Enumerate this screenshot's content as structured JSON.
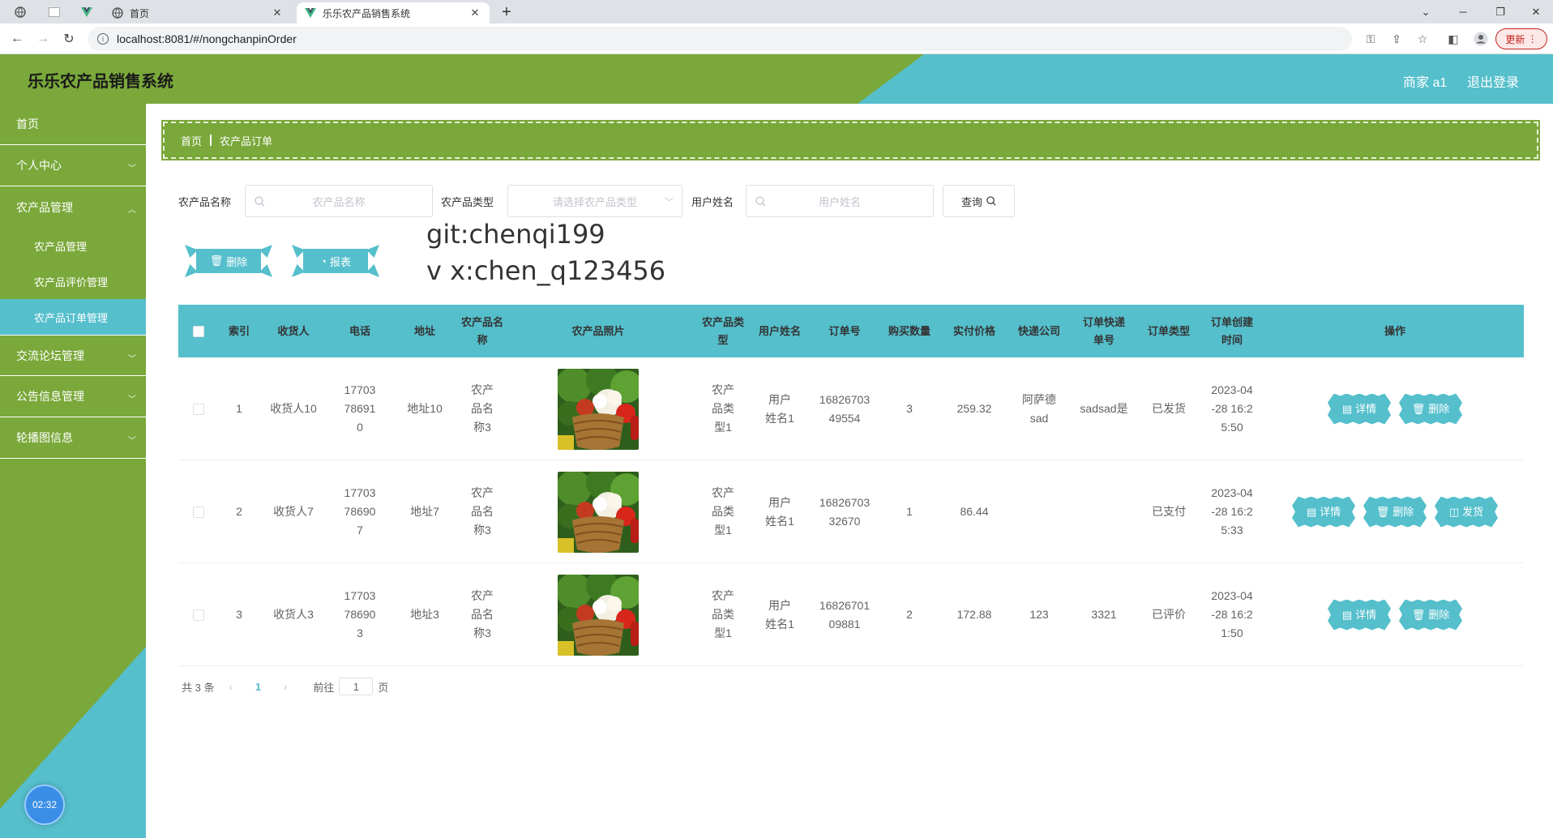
{
  "browser": {
    "tabs": [
      {
        "label": "首页",
        "active": false
      },
      {
        "label": "乐乐农产品销售系统",
        "active": true
      }
    ],
    "url": "localhost:8081/#/nongchanpinOrder",
    "update_label": "更新"
  },
  "header": {
    "title": "乐乐农产品销售系统",
    "user_label": "商家 a1",
    "logout_label": "退出登录"
  },
  "sidebar": {
    "items": [
      {
        "label": "首页"
      },
      {
        "label": "个人中心"
      },
      {
        "label": "农产品管理"
      },
      {
        "label": "农产品管理"
      },
      {
        "label": "农产品评价管理"
      },
      {
        "label": "农产品订单管理"
      },
      {
        "label": "交流论坛管理"
      },
      {
        "label": "公告信息管理"
      },
      {
        "label": "轮播图信息"
      }
    ],
    "timer": "02:32"
  },
  "breadcrumb": {
    "home": "首页",
    "current": "农产品订单"
  },
  "search": {
    "product_name_label": "农产品名称",
    "product_name_placeholder": "农产品名称",
    "product_type_label": "农产品类型",
    "product_type_placeholder": "请选择农产品类型",
    "user_name_label": "用户姓名",
    "user_name_placeholder": "用户姓名",
    "query_label": "查询"
  },
  "actions": {
    "delete_label": "删除",
    "report_label": "报表"
  },
  "watermark": {
    "line1": "git:chenqi199",
    "line2": "v x:chen_q123456"
  },
  "table": {
    "headers": {
      "index": "索引",
      "receiver": "收货人",
      "phone": "电话",
      "address": "地址",
      "product_name": "农产品名称",
      "product_photo": "农产品照片",
      "product_type": "农产品类型",
      "user_name": "用户姓名",
      "order_no": "订单号",
      "quantity": "购买数量",
      "price": "实付价格",
      "courier": "快递公司",
      "tracking_no": "订单快递单号",
      "order_type": "订单类型",
      "created": "订单创建时间",
      "ops": "操作"
    },
    "rows": [
      {
        "index": "1",
        "receiver": "收货人10",
        "phone": "17703786910",
        "address": "地址10",
        "product_name": "农产品名称3",
        "product_type": "农产品类型1",
        "user_name": "用户姓名1",
        "order_no": "1682670349554",
        "quantity": "3",
        "price": "259.32",
        "courier": "阿萨德sad",
        "tracking_no": "sadsad是",
        "order_type": "已发货",
        "created": "2023-04-28 16:25:50",
        "ops": [
          "详情",
          "删除"
        ]
      },
      {
        "index": "2",
        "receiver": "收货人7",
        "phone": "17703786907",
        "address": "地址7",
        "product_name": "农产品名称3",
        "product_type": "农产品类型1",
        "user_name": "用户姓名1",
        "order_no": "1682670332670",
        "quantity": "1",
        "price": "86.44",
        "courier": "",
        "tracking_no": "",
        "order_type": "已支付",
        "created": "2023-04-28 16:25:33",
        "ops": [
          "详情",
          "删除",
          "发货"
        ]
      },
      {
        "index": "3",
        "receiver": "收货人3",
        "phone": "17703786903",
        "address": "地址3",
        "product_name": "农产品名称3",
        "product_type": "农产品类型1",
        "user_name": "用户姓名1",
        "order_no": "1682670109881",
        "quantity": "2",
        "price": "172.88",
        "courier": "123",
        "tracking_no": "3321",
        "order_type": "已评价",
        "created": "2023-04-28 16:21:50",
        "ops": [
          "详情",
          "删除"
        ]
      }
    ]
  },
  "pager": {
    "total": "共 3 条",
    "current": "1",
    "goto_label": "前往",
    "goto_value": "1",
    "page_suffix": "页"
  },
  "colors": {
    "green": "#7aa83a",
    "teal": "#55bfcc"
  }
}
